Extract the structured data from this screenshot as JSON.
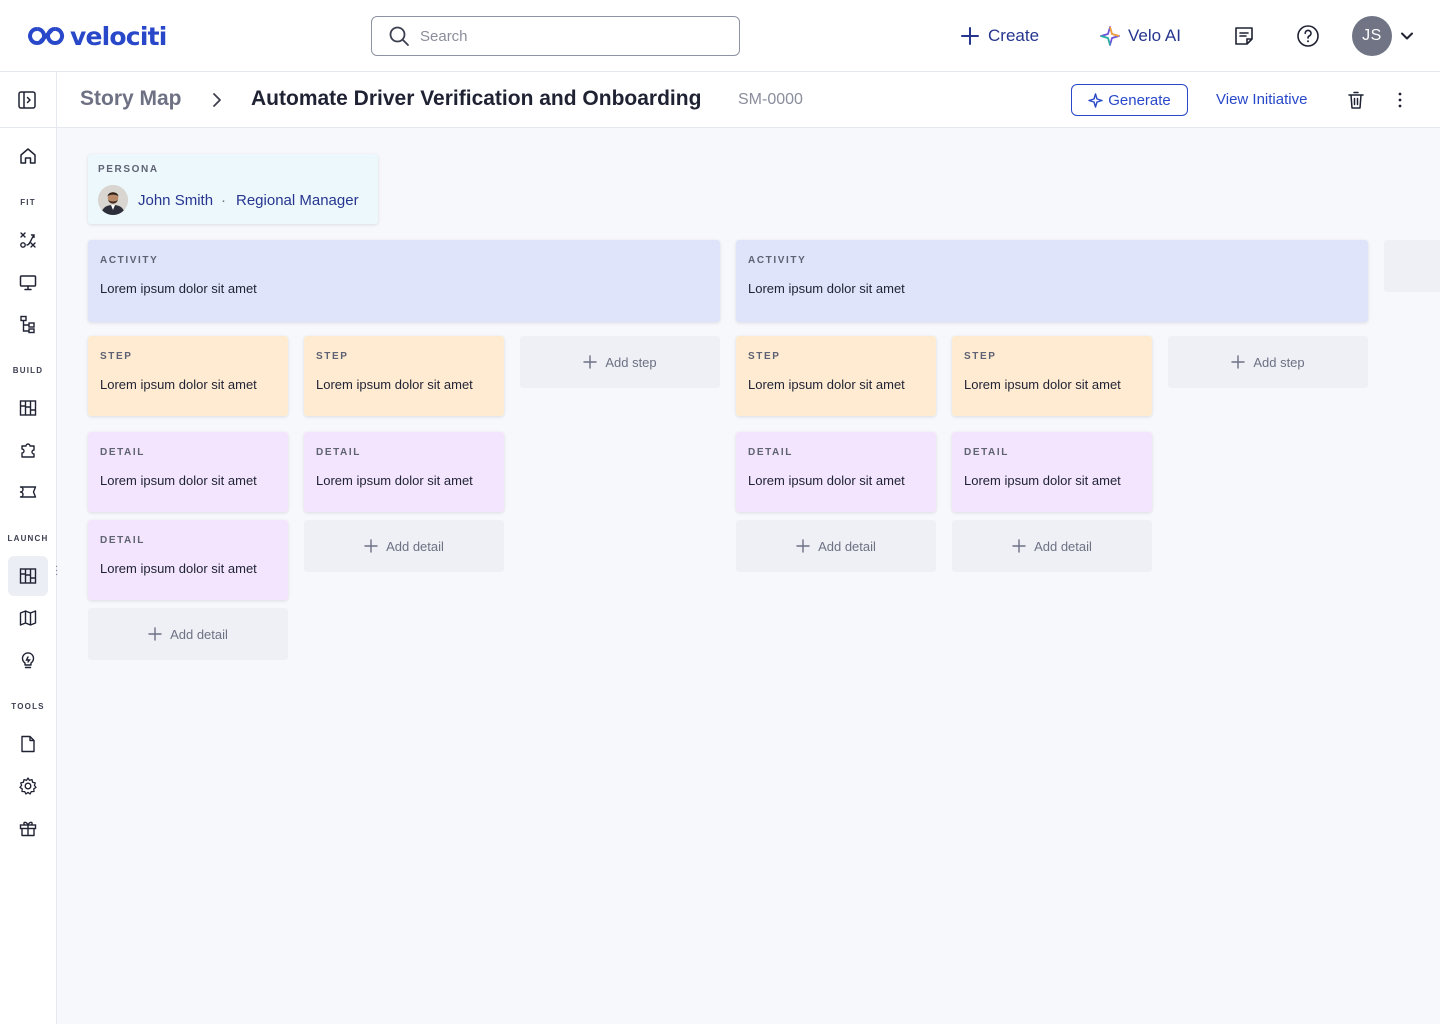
{
  "app": {
    "brand": "velociti"
  },
  "header": {
    "search_placeholder": "Search",
    "create_label": "Create",
    "veloai_label": "Velo AI",
    "user_initials": "JS"
  },
  "subheader": {
    "breadcrumb_root": "Story Map",
    "title": "Automate Driver Verification and Onboarding",
    "id": "SM-0000",
    "generate_label": "Generate",
    "view_initiative_label": "View Initiative"
  },
  "sidebar": {
    "sections": [
      "FIT",
      "BUILD",
      "LAUNCH",
      "TOOLS"
    ],
    "items": [
      {
        "icon": "home-icon"
      },
      {
        "icon": "fit-tools-icon"
      },
      {
        "icon": "presentation-icon"
      },
      {
        "icon": "hierarchy-icon"
      },
      {
        "icon": "board-icon"
      },
      {
        "icon": "puzzle-icon"
      },
      {
        "icon": "ticket-icon"
      },
      {
        "icon": "story-map-icon",
        "active": true
      },
      {
        "icon": "map-icon"
      },
      {
        "icon": "lightbulb-icon"
      },
      {
        "icon": "document-icon"
      },
      {
        "icon": "settings-icon"
      },
      {
        "icon": "gift-icon"
      }
    ]
  },
  "persona": {
    "label": "PERSONA",
    "name": "John Smith",
    "separator": "·",
    "role": "Regional Manager"
  },
  "labels": {
    "activity": "ACTIVITY",
    "step": "STEP",
    "detail": "DETAIL",
    "add_step": "Add step",
    "add_detail": "Add detail"
  },
  "activities": [
    {
      "text": "Lorem ipsum dolor sit amet",
      "steps": [
        {
          "text": "Lorem ipsum dolor sit amet",
          "details": [
            "Lorem ipsum dolor sit amet",
            "Lorem ipsum dolor sit amet"
          ]
        },
        {
          "text": "Lorem ipsum dolor sit amet",
          "details": [
            "Lorem ipsum dolor sit amet"
          ]
        }
      ]
    },
    {
      "text": "Lorem ipsum dolor sit amet",
      "steps": [
        {
          "text": "Lorem ipsum dolor sit amet",
          "details": [
            "Lorem ipsum dolor sit amet"
          ]
        },
        {
          "text": "Lorem ipsum dolor sit amet",
          "details": [
            "Lorem ipsum dolor sit amet"
          ]
        }
      ]
    }
  ],
  "colors": {
    "brand": "#2848c9",
    "activity_bg": "#e0e4fa",
    "step_bg": "#feebd2",
    "detail_bg": "#f3e5fd",
    "persona_bg": "#edf8fd"
  }
}
